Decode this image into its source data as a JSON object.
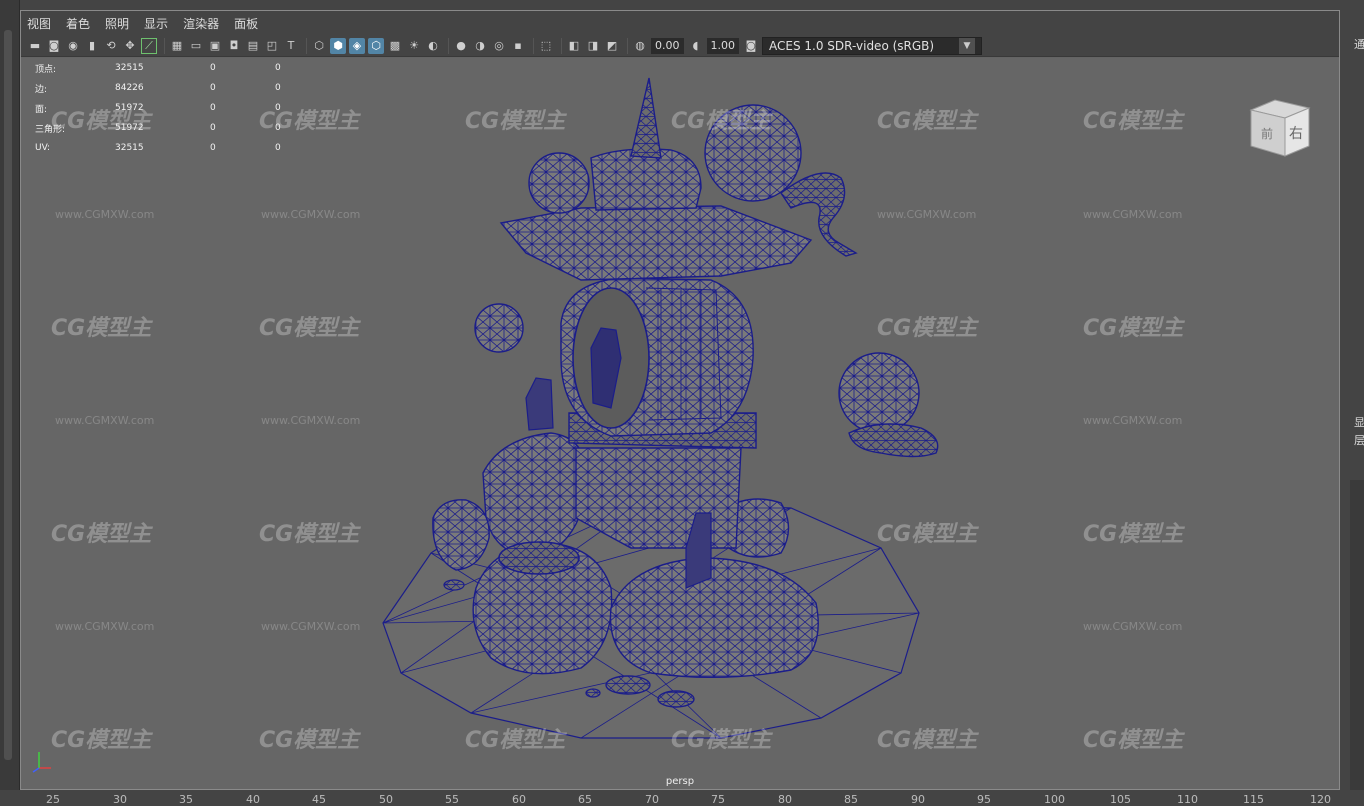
{
  "menu": [
    "视图",
    "着色",
    "照明",
    "显示",
    "渲染器",
    "面板"
  ],
  "toolbar": {
    "exposure": "0.00",
    "gamma": "1.00",
    "colorspace": "ACES 1.0 SDR-video (sRGB)"
  },
  "hud": [
    {
      "label": "顶点:",
      "v1": "32515",
      "v2": "0",
      "v3": "0"
    },
    {
      "label": "边:",
      "v1": "84226",
      "v2": "0",
      "v3": "0"
    },
    {
      "label": "面:",
      "v1": "51972",
      "v2": "0",
      "v3": "0"
    },
    {
      "label": "三角形:",
      "v1": "51972",
      "v2": "0",
      "v3": "0"
    },
    {
      "label": "UV:",
      "v1": "32515",
      "v2": "0",
      "v3": "0"
    }
  ],
  "camera": "persp",
  "viewcube": {
    "front": "前",
    "right": "右"
  },
  "watermark": {
    "logo": "CG模型主",
    "url": "www.CGMXW.com"
  },
  "right_panel": [
    "通",
    "显",
    "层"
  ],
  "timeline": [
    "25",
    "30",
    "35",
    "40",
    "45",
    "50",
    "55",
    "60",
    "65",
    "70",
    "75",
    "80",
    "85",
    "90",
    "95",
    "100",
    "105",
    "110",
    "115",
    "120"
  ],
  "colors": {
    "wire": "#1b1d8a",
    "mesh": "#7a7a7a",
    "viewport": "#666666"
  }
}
